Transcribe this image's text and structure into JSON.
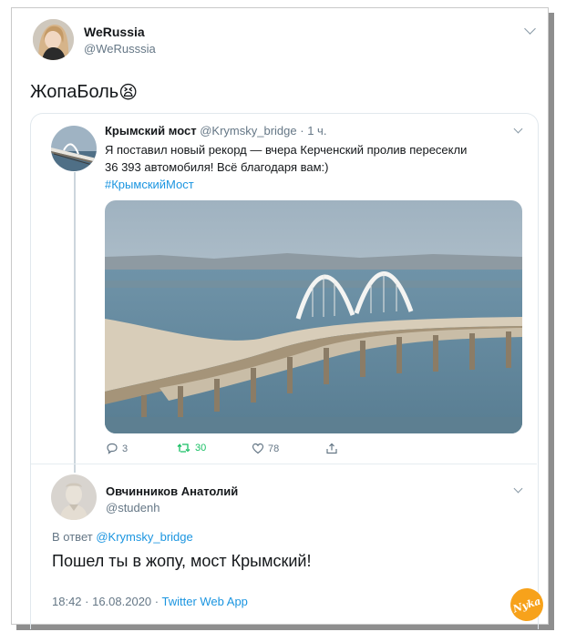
{
  "colors": {
    "accent": "#1b95e0",
    "retweet": "#17bf63",
    "muted": "#657786",
    "watermark": "#f7a21b"
  },
  "main_tweet": {
    "display_name": "WeRussia",
    "handle": "@WeRusssia",
    "text": "ЖопаБоль",
    "emoji": "😫",
    "menu_icon": "chevron-down-icon"
  },
  "quoted_tweet": {
    "display_name": "Крымский мост",
    "handle": "@Krymsky_bridge",
    "separator": "·",
    "time": "1 ч.",
    "text_line1": "Я поставил новый рекорд — вчера Керченский пролив пересекли",
    "text_line2": "36 393 автомобиля! Всё благодаря вам:)",
    "hashtag": "#КрымскийМост",
    "stats": {
      "replies": "3",
      "retweets": "30",
      "likes": "78"
    }
  },
  "reply_tweet": {
    "display_name": "Овчинников Анатолий",
    "handle": "@studenh",
    "reply_prefix": "В ответ",
    "reply_to": "@Krymsky_bridge",
    "text": "Пошел ты в жопу, мост Крымский!",
    "timestamp": "18:42 · 16.08.2020 ·",
    "source": "Twitter Web App"
  },
  "watermark": {
    "text": "Nyka"
  }
}
